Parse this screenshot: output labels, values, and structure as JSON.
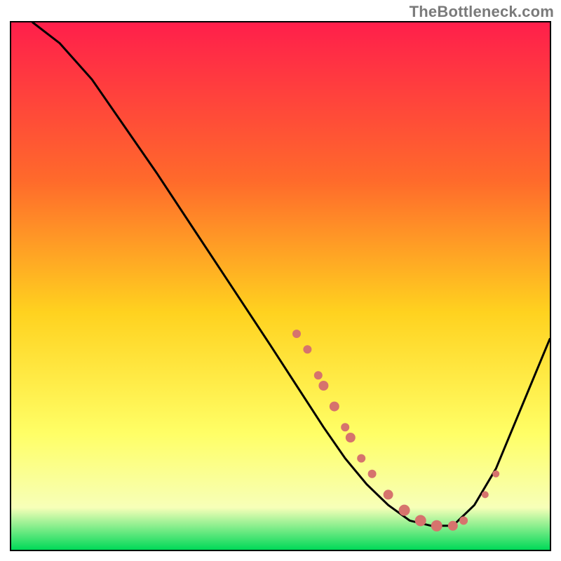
{
  "watermark": "TheBottleneck.com",
  "colors": {
    "gradient_top": "#ff1f4b",
    "gradient_mid1": "#ff6a2b",
    "gradient_mid2": "#ffd21f",
    "gradient_mid3": "#ffff66",
    "gradient_mid4": "#f7ffb8",
    "gradient_bottom": "#00d958",
    "curve": "#000000",
    "marker": "#d6736d"
  },
  "chart_data": {
    "type": "line",
    "title": "",
    "xlabel": "",
    "ylabel": "",
    "xlim": [
      0,
      100
    ],
    "ylim": [
      0,
      100
    ],
    "curve": [
      {
        "x": 4,
        "y": 100
      },
      {
        "x": 9,
        "y": 96
      },
      {
        "x": 15,
        "y": 89
      },
      {
        "x": 21,
        "y": 80
      },
      {
        "x": 27,
        "y": 71
      },
      {
        "x": 34,
        "y": 60
      },
      {
        "x": 41,
        "y": 49
      },
      {
        "x": 48,
        "y": 38
      },
      {
        "x": 53,
        "y": 30
      },
      {
        "x": 58,
        "y": 22
      },
      {
        "x": 62,
        "y": 16
      },
      {
        "x": 66,
        "y": 11
      },
      {
        "x": 70,
        "y": 7
      },
      {
        "x": 74,
        "y": 4
      },
      {
        "x": 78,
        "y": 3
      },
      {
        "x": 82,
        "y": 3
      },
      {
        "x": 86,
        "y": 7
      },
      {
        "x": 90,
        "y": 14
      },
      {
        "x": 94,
        "y": 24
      },
      {
        "x": 98,
        "y": 34
      },
      {
        "x": 100,
        "y": 39
      }
    ],
    "markers": [
      {
        "x": 53,
        "y": 40,
        "r": 6
      },
      {
        "x": 55,
        "y": 37,
        "r": 6
      },
      {
        "x": 57,
        "y": 32,
        "r": 6
      },
      {
        "x": 58,
        "y": 30,
        "r": 7
      },
      {
        "x": 60,
        "y": 26,
        "r": 7
      },
      {
        "x": 62,
        "y": 22,
        "r": 6
      },
      {
        "x": 63,
        "y": 20,
        "r": 7
      },
      {
        "x": 65,
        "y": 16,
        "r": 6
      },
      {
        "x": 67,
        "y": 13,
        "r": 6
      },
      {
        "x": 70,
        "y": 9,
        "r": 7
      },
      {
        "x": 73,
        "y": 6,
        "r": 8
      },
      {
        "x": 76,
        "y": 4,
        "r": 8
      },
      {
        "x": 79,
        "y": 3,
        "r": 8
      },
      {
        "x": 82,
        "y": 3,
        "r": 7
      },
      {
        "x": 84,
        "y": 4,
        "r": 6
      },
      {
        "x": 88,
        "y": 9,
        "r": 5
      },
      {
        "x": 90,
        "y": 13,
        "r": 5
      }
    ]
  }
}
